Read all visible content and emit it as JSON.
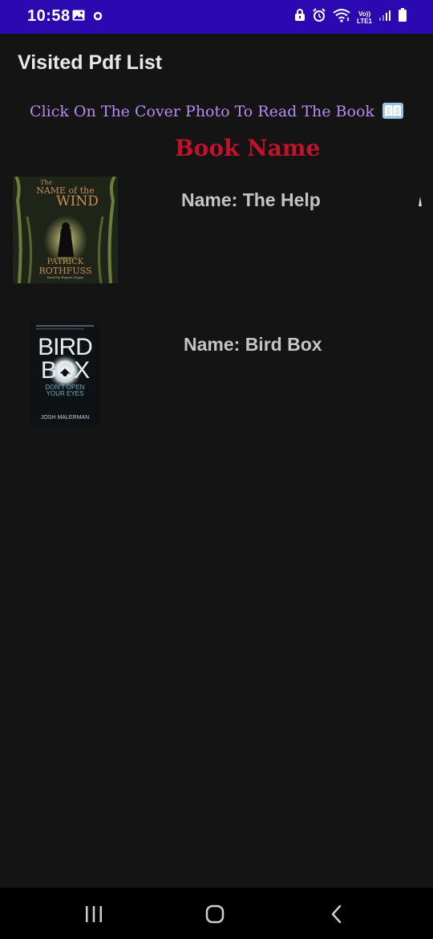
{
  "status_bar": {
    "time": "10:58",
    "network_label": "LTE1",
    "volte_label": "Vo))",
    "icons": [
      "gallery-icon",
      "circle-notification-icon",
      "lock-icon",
      "alarm-icon",
      "wifi-icon",
      "signal-icon",
      "battery-icon"
    ]
  },
  "app_bar": {
    "title": "Visited Pdf List"
  },
  "instruction": {
    "text": "Click On The Cover Photo To Read The Book",
    "icon": "open-book-icon"
  },
  "list": {
    "header": "Book Name",
    "items": [
      {
        "name_text": "Name: The Help",
        "cover_title_line1": "The",
        "cover_title_line2": "NAME of the",
        "cover_title_line3": "WIND",
        "cover_author1": "PATRICK",
        "cover_author2": "ROTHFUSS",
        "cover_footer": "Read by Rupert Degas"
      },
      {
        "name_text": "Name: Bird Box",
        "cover_title_line1": "BIRD",
        "cover_title_line2": "BOX",
        "cover_tagline": "DON'T OPEN YOUR EYES",
        "cover_author": "JOSH MALERMAN"
      }
    ]
  },
  "colors": {
    "status_bar_bg": "#2a0ab0",
    "background": "#141414",
    "title_text": "#e8e8e8",
    "instruction_text": "#b48cf0",
    "header_text": "#c0122c",
    "item_text": "#c4c4c4",
    "nav_bar_bg": "#000000"
  },
  "nav_bar": {
    "icons": [
      "recent-apps-icon",
      "home-icon",
      "back-icon"
    ]
  }
}
